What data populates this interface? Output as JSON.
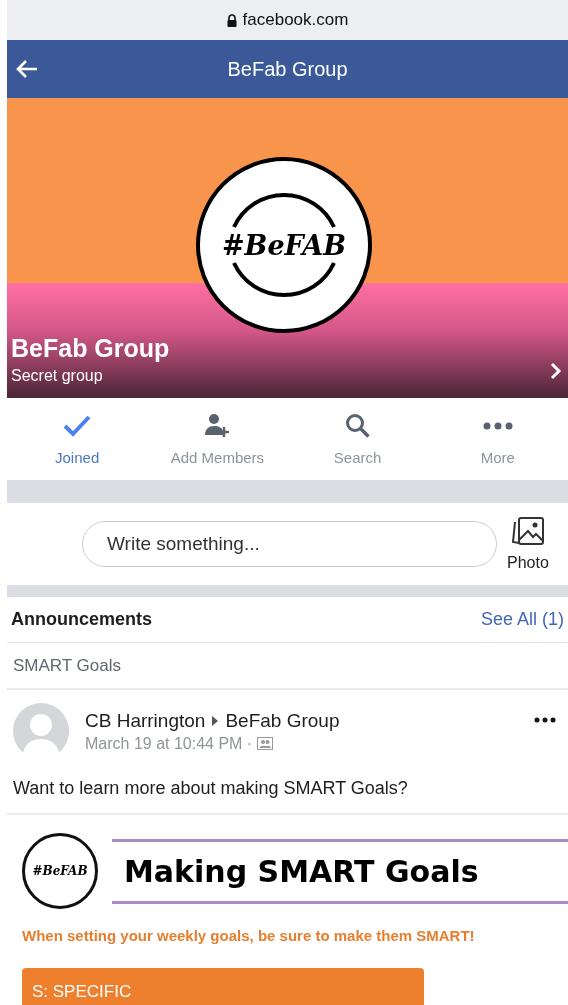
{
  "address_bar": {
    "url": "facebook.com"
  },
  "nav_bar": {
    "title": "BeFab Group"
  },
  "cover": {
    "logo_text": "#BeFAB",
    "group_name": "BeFab Group",
    "privacy": "Secret group"
  },
  "actions": [
    {
      "kind": "joined",
      "label": "Joined",
      "selected": true
    },
    {
      "kind": "add",
      "label": "Add Members",
      "selected": false
    },
    {
      "kind": "search",
      "label": "Search",
      "selected": false
    },
    {
      "kind": "more",
      "label": "More",
      "selected": false
    }
  ],
  "composer": {
    "placeholder": "Write something...",
    "photo_label": "Photo"
  },
  "announcements": {
    "title": "Announcements",
    "see_all": "See All (1)",
    "topic": "SMART Goals"
  },
  "post": {
    "author": "CB Harrington",
    "group": "BeFab Group",
    "time": "March 19 at 10:44 PM ·",
    "text": "Want to learn more about making SMART Goals?",
    "graphic": {
      "logo_text": "#BeFAB",
      "heading": "Making SMART Goals",
      "subtitle": "When setting your weekly goals, be sure to make them SMART!",
      "section": "S: SPECIFIC"
    }
  }
}
